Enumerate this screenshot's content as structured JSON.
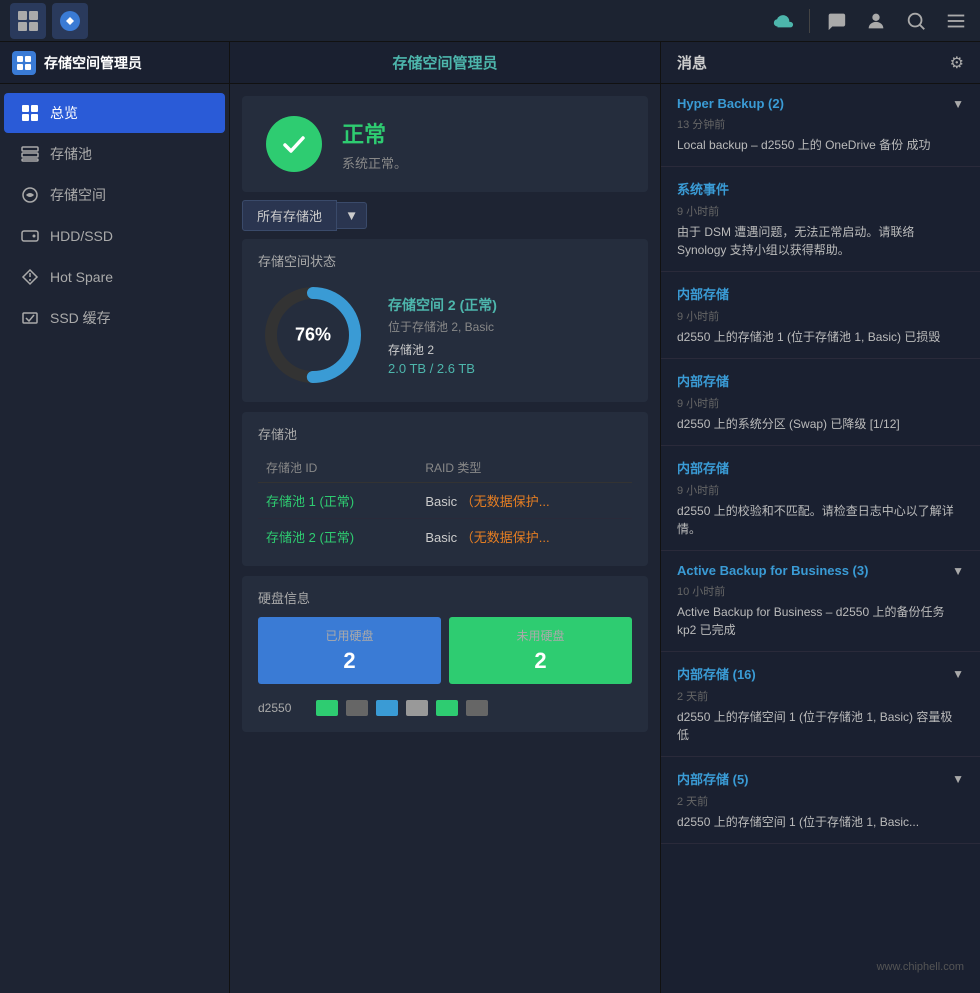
{
  "taskbar": {
    "app1_label": "apps-icon",
    "app2_label": "storage-icon",
    "cloud_icon": "☁",
    "chat_icon": "💬",
    "user_icon": "👤",
    "search_icon": "🔍",
    "menu_icon": "☰"
  },
  "sidebar": {
    "header_title": "存储空间管理员",
    "nav_items": [
      {
        "id": "overview",
        "label": "总览",
        "active": true
      },
      {
        "id": "pool",
        "label": "存储池",
        "active": false
      },
      {
        "id": "space",
        "label": "存储空间",
        "active": false
      },
      {
        "id": "hdd",
        "label": "HDD/SSD",
        "active": false
      },
      {
        "id": "hotspare",
        "label": "Hot Spare",
        "active": false
      },
      {
        "id": "ssdcache",
        "label": "SSD 缓存",
        "active": false
      }
    ]
  },
  "content": {
    "header_title": "存储空间管理员",
    "status": {
      "title": "正常",
      "subtitle": "系统正常。"
    },
    "pool_selector": "所有存储池",
    "storage_status": {
      "section_title": "存储空间状态",
      "donut_percent": "76%",
      "storage_name": "存储空间 2 (正常)",
      "storage_location": "位于存储池 2, Basic",
      "pool_label": "存储池 2",
      "size_used": "2.0 TB",
      "size_total": "2.6 TB"
    },
    "pool_table": {
      "section_title": "存储池",
      "col_id": "存储池 ID",
      "col_raid": "RAID 类型",
      "rows": [
        {
          "id": "存储池 1 (正常)",
          "raid": "Basic (无数据保护..."
        },
        {
          "id": "存储池 2 (正常)",
          "raid": "Basic (无数据保护..."
        }
      ]
    },
    "disk_info": {
      "section_title": "硬盘信息",
      "used_label": "已用硬盘",
      "used_count": "2",
      "unused_label": "未用硬盘",
      "unused_count": "2"
    },
    "device": {
      "name": "d2550",
      "slots": [
        "green",
        "gray",
        "blue",
        "lightgray",
        "green",
        "gray"
      ]
    }
  },
  "messages": {
    "panel_title": "消息",
    "groups": [
      {
        "title": "Hyper Backup (2)",
        "time": "13 分钟前",
        "text": "Local backup – d2550 上的 OneDrive 备份 成功"
      },
      {
        "title": "系统事件",
        "time": "9 小时前",
        "text": "由于 DSM 遭遇问题，无法正常启动。请联络 Synology 支持小组以获得帮助。"
      },
      {
        "title": "内部存储",
        "time": "9 小时前",
        "text": "d2550 上的存储池 1 (位于存储池 1, Basic) 已损毁"
      },
      {
        "title": "内部存储",
        "time": "9 小时前",
        "text": "d2550 上的系统分区 (Swap) 已降级 [1/12]"
      },
      {
        "title": "内部存储",
        "time": "9 小时前",
        "text": "d2550 上的校验和不匹配。请检查日志中心以了解详情。"
      },
      {
        "title": "Active Backup for Business (3)",
        "time": "10 小时前",
        "text": "Active Backup for Business – d2550 上的备份任务 kp2 已完成"
      },
      {
        "title": "内部存储 (16)",
        "time": "2 天前",
        "text": "d2550 上的存储空间 1 (位于存储池 1, Basic) 容量极低"
      },
      {
        "title": "内部存储 (5)",
        "time": "2 天前",
        "text": "d2550 上的存储空间 1 (位于存储池 1, Basic..."
      }
    ]
  },
  "watermark": "www.chiphell.com"
}
